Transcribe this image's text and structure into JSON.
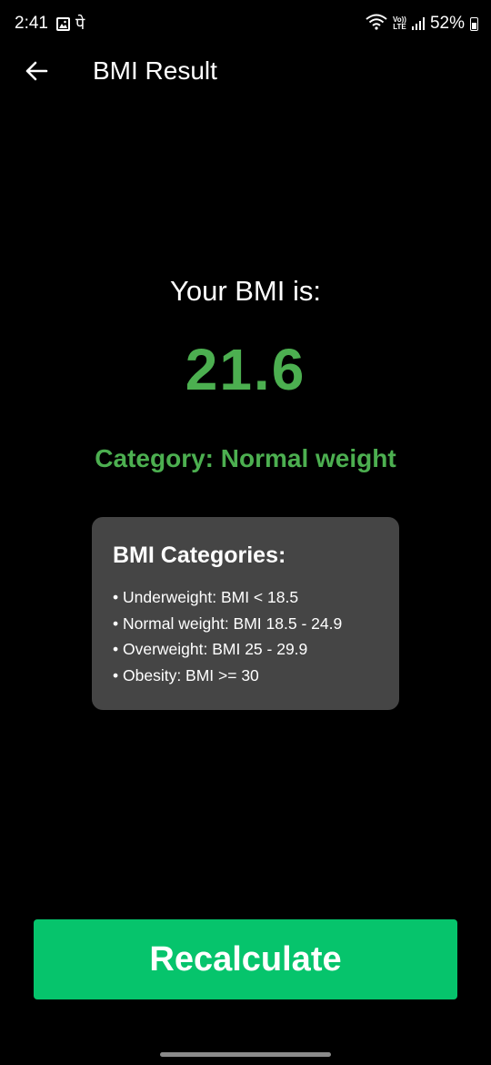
{
  "status_bar": {
    "time": "2:41",
    "notification_glyph": "पे",
    "network_label_top": "Vo))",
    "network_label_bottom": "LTE",
    "battery_percent": "52%",
    "battery_level": 0.52,
    "icons": [
      "gallery-icon",
      "wifi-icon",
      "volte-icon",
      "signal-icon",
      "battery-icon"
    ]
  },
  "app_bar": {
    "title": "BMI Result",
    "back_icon": "arrow-left-icon"
  },
  "result": {
    "heading": "Your BMI is:",
    "bmi_value": "21.6",
    "category_text": "Category: Normal weight"
  },
  "categories_card": {
    "title": "BMI Categories:",
    "items": [
      "• Underweight: BMI < 18.5",
      "• Normal weight: BMI 18.5 - 24.9",
      "• Overweight: BMI 25 - 29.9",
      "• Obesity: BMI >= 30"
    ]
  },
  "actions": {
    "recalculate_label": "Recalculate"
  },
  "colors": {
    "background": "#000000",
    "accent_green": "#4caf50",
    "button_green": "#06c46c",
    "card_background": "#454545",
    "text_primary": "#ffffff"
  }
}
